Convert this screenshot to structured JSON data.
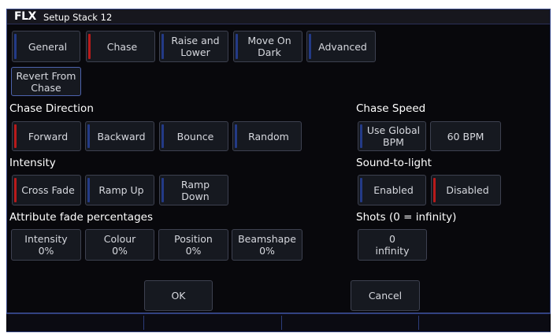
{
  "window": {
    "logo": "FLX",
    "title": "Setup Stack 12"
  },
  "tabs": [
    {
      "label": "General",
      "bar": "blue"
    },
    {
      "label": "Chase",
      "bar": "red"
    },
    {
      "label": "Raise and\nLower",
      "bar": "blue"
    },
    {
      "label": "Move On\nDark",
      "bar": "blue"
    },
    {
      "label": "Advanced",
      "bar": "blue"
    }
  ],
  "revert_label": "Revert From\nChase",
  "chase_direction": {
    "heading": "Chase Direction",
    "options": [
      "Forward",
      "Backward",
      "Bounce",
      "Random"
    ],
    "selected": "Forward"
  },
  "intensity": {
    "heading": "Intensity",
    "options": [
      "Cross Fade",
      "Ramp Up",
      "Ramp\nDown"
    ],
    "selected": "Cross Fade"
  },
  "attribute_fades": {
    "heading": "Attribute fade percentages",
    "items": [
      "Intensity\n0%",
      "Colour\n0%",
      "Position\n0%",
      "Beamshape\n0%"
    ]
  },
  "chase_speed": {
    "heading": "Chase Speed",
    "use_global_label": "Use Global\nBPM",
    "bpm_label": "60 BPM"
  },
  "sound_to_light": {
    "heading": "Sound-to-light",
    "options": [
      "Enabled",
      "Disabled"
    ],
    "selected": "Disabled"
  },
  "shots": {
    "heading": "Shots (0 = infinity)",
    "value_label": "0\ninfinity"
  },
  "actions": {
    "ok_label": "OK",
    "cancel_label": "Cancel"
  },
  "colors": {
    "accent_blue": "#233a86",
    "selected_red": "#b81a1a",
    "window_bg": "#08080c"
  }
}
